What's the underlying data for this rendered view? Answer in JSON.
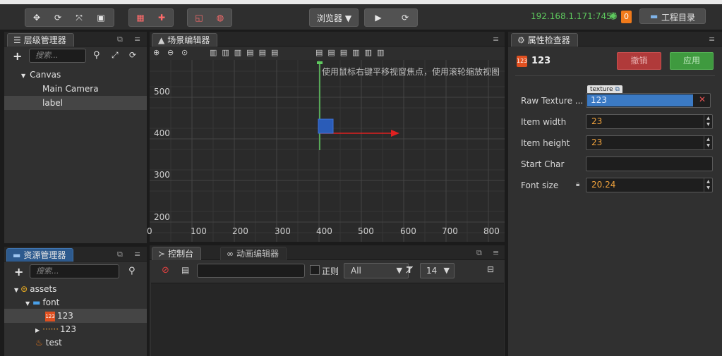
{
  "toolbar": {
    "browser_label": "浏览器 ▼",
    "network_address": "192.168.1.171:7456",
    "notification_count": "0",
    "project_dir_label": "工程目录"
  },
  "hierarchy": {
    "tab_label": "层级管理器",
    "search_placeholder": "搜索...",
    "items": [
      {
        "label": "Canvas"
      },
      {
        "label": "Main Camera"
      },
      {
        "label": "label"
      }
    ]
  },
  "scene": {
    "tab_label": "场景编辑器",
    "hint": "使用鼠标右键平移视窗焦点，使用滚轮缩放视图",
    "y_labels": [
      "500",
      "400",
      "300",
      "200"
    ],
    "x_labels": [
      "0",
      "100",
      "200",
      "300",
      "400",
      "500",
      "600",
      "700",
      "800"
    ]
  },
  "inspector": {
    "tab_label": "属性检查器",
    "node_name": "123",
    "revert_label": "撤销",
    "apply_label": "应用",
    "texture_tag": "texture",
    "raw_texture_label": "Raw Texture ...",
    "raw_texture_value": "123",
    "item_width_label": "Item width",
    "item_width_value": "23",
    "item_height_label": "Item height",
    "item_height_value": "23",
    "start_char_label": "Start Char",
    "start_char_value": "",
    "font_size_label": "Font size",
    "font_size_value": "20.24"
  },
  "assets": {
    "tab_label": "资源管理器",
    "search_placeholder": "搜索...",
    "items": [
      {
        "label": "assets"
      },
      {
        "label": "font"
      },
      {
        "label": "123"
      },
      {
        "label": "123"
      },
      {
        "label": "test"
      }
    ]
  },
  "console": {
    "tab_console": "控制台",
    "tab_animation": "动画编辑器",
    "regex_label": "正则",
    "filter_value": "All",
    "font_size_value": "14"
  },
  "colors": {
    "accent_blue": "#2d5a8e",
    "revert_red": "#b03a3a",
    "apply_green": "#3f9a3f",
    "ip_green": "#5ec95e",
    "orange": "#f0a23c"
  }
}
